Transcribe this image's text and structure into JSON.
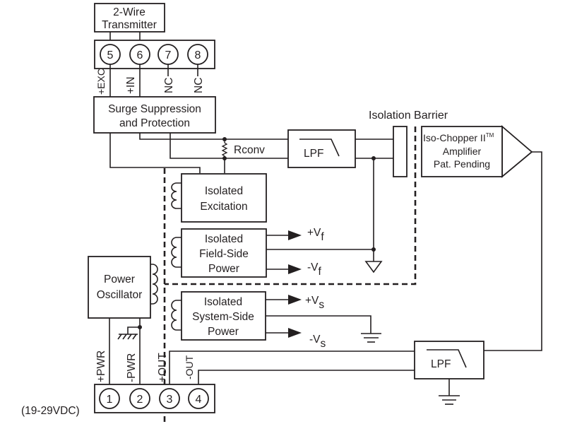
{
  "diagram": {
    "transmitter": {
      "line1": "2-Wire",
      "line2": "Transmitter"
    },
    "input_terminals": [
      {
        "number": "5",
        "label": "+EXC"
      },
      {
        "number": "6",
        "label": "+IN"
      },
      {
        "number": "7",
        "label": "NC"
      },
      {
        "number": "8",
        "label": "NC"
      }
    ],
    "surge": {
      "line1": "Surge Suppression",
      "line2": "and Protection"
    },
    "resistor_label": "Rconv",
    "lpf_input_label": "LPF",
    "lpf_output_label": "LPF",
    "isolation_barrier_label": "Isolation Barrier",
    "amplifier": {
      "line1": "Iso-Chopper II",
      "tm": "TM",
      "line2": "Amplifier",
      "line3": "Pat. Pending"
    },
    "excitation": {
      "line1": "Isolated",
      "line2": "Excitation"
    },
    "field_power": {
      "line1": "Isolated",
      "line2": "Field-Side",
      "line3": "Power",
      "plus": "+V",
      "minus": "-V",
      "sub": "f"
    },
    "system_power": {
      "line1": "Isolated",
      "line2": "System-Side",
      "line3": "Power",
      "plus": "+V",
      "minus": "-V",
      "sub": "s"
    },
    "oscillator": {
      "line1": "Power",
      "line2": "Oscillator"
    },
    "output_terminals": [
      {
        "number": "1",
        "label": "+PWR"
      },
      {
        "number": "2",
        "label": "-PWR"
      },
      {
        "number": "3",
        "label": "+OUT"
      },
      {
        "number": "4",
        "label": "-OUT"
      }
    ],
    "supply_range": "(19-29VDC)"
  }
}
